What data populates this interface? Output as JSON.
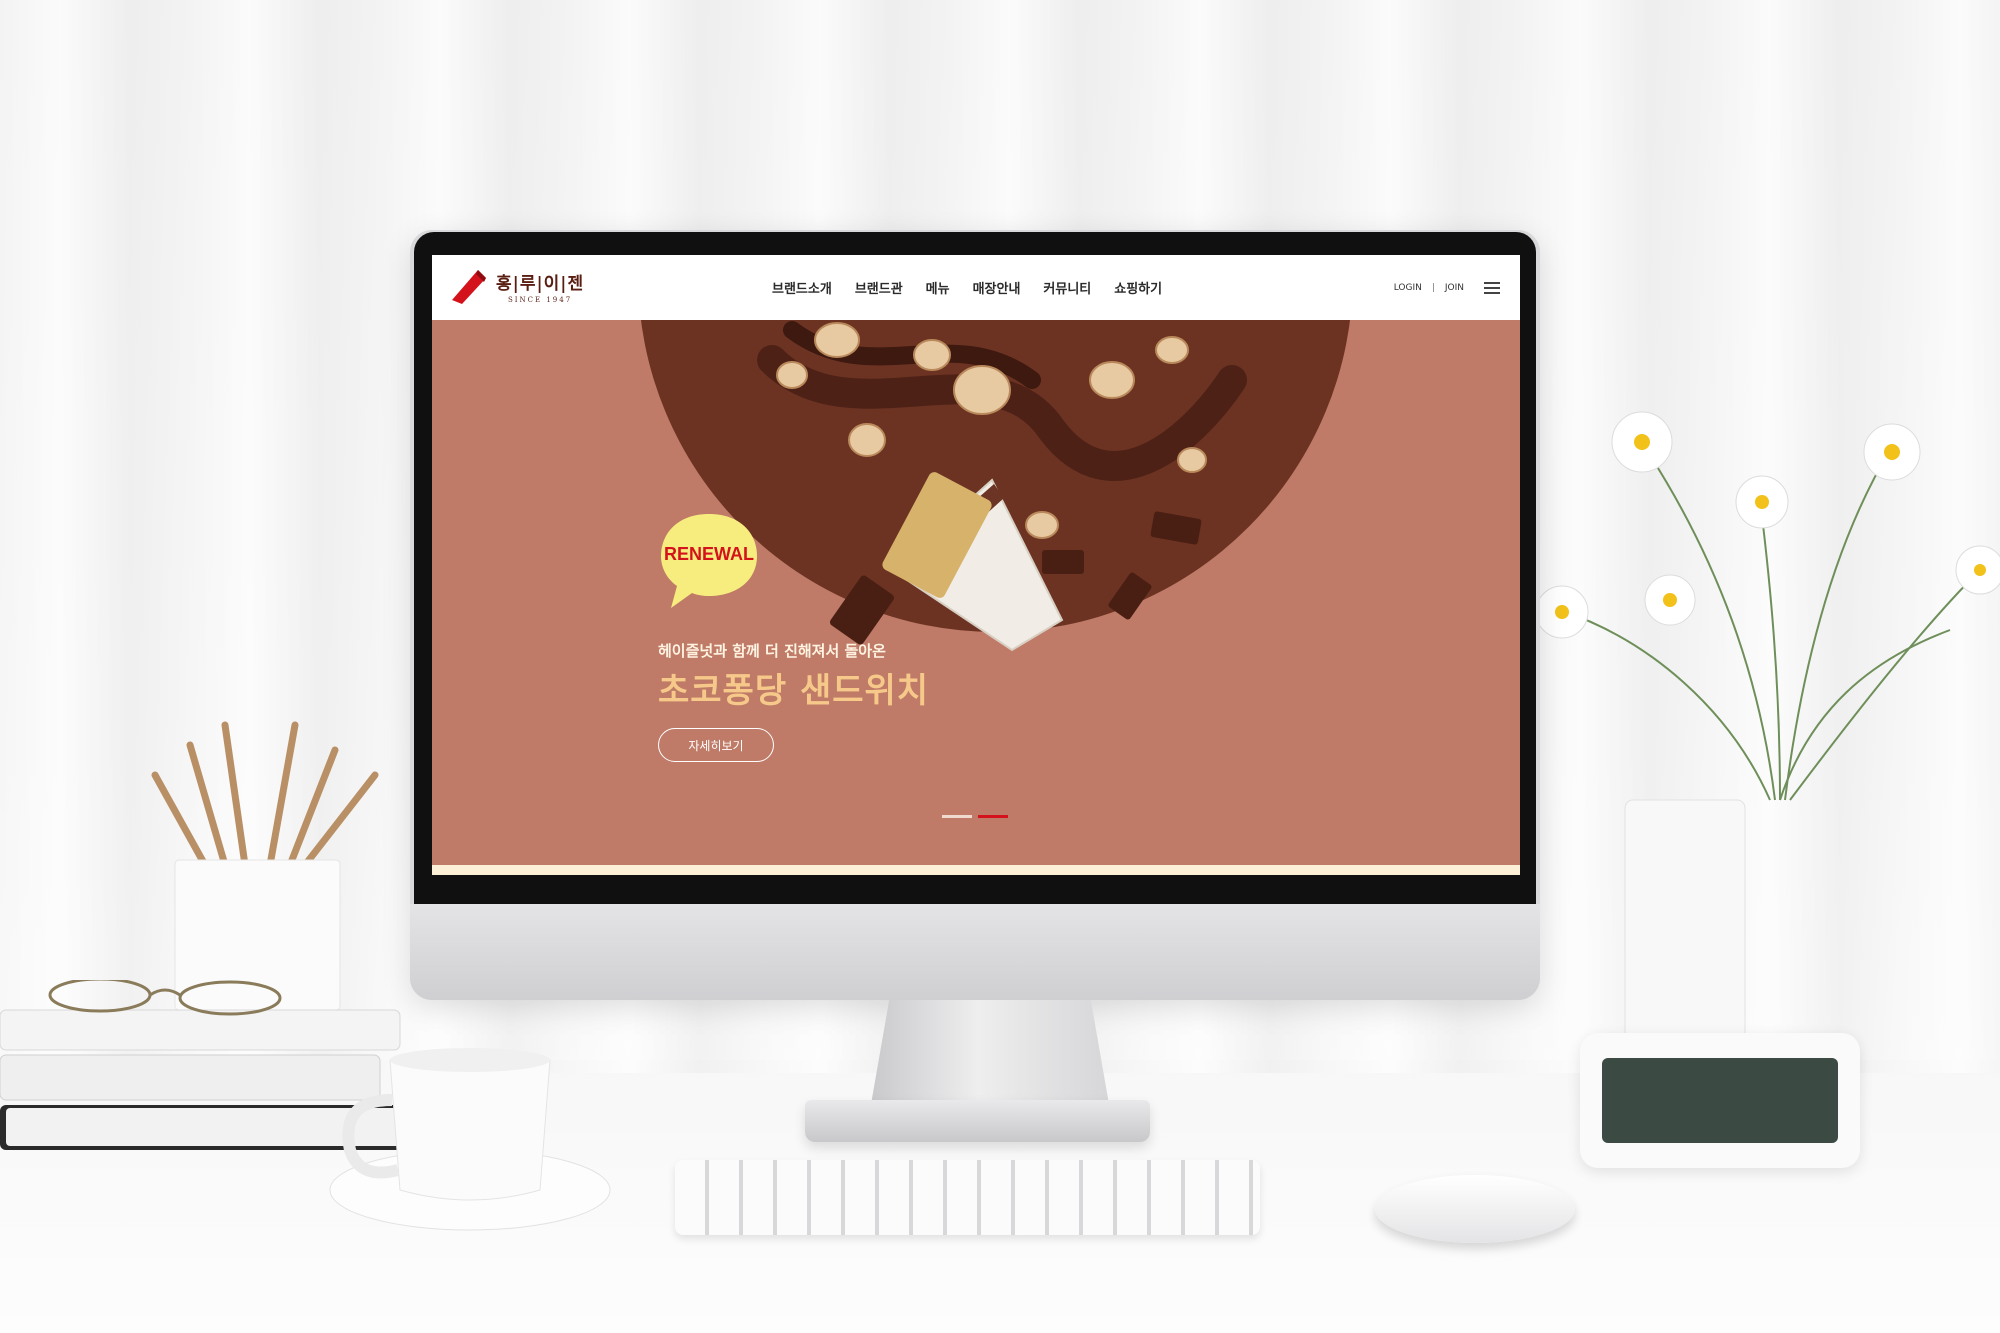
{
  "brand": {
    "name": "홍|루|이|젠",
    "since": "SINCE 1947"
  },
  "nav": {
    "items": [
      "브랜드소개",
      "브랜드관",
      "메뉴",
      "매장안내",
      "커뮤니티",
      "쇼핑하기"
    ]
  },
  "util": {
    "login": "LOGIN",
    "separator": "|",
    "join": "JOIN"
  },
  "hero": {
    "badge": "RENEWAL",
    "sub_copy": "헤이즐넛과 함께 더 진해져서 돌아온",
    "main_copy": "초코퐁당 샌드위치",
    "button_label": "자세히보기",
    "slides": 2,
    "active_slide": 2
  },
  "colors": {
    "hero_bg": "#bf7b67",
    "bowl": "#6c3323",
    "accent": "#d4121b",
    "headline": "#f6c98a"
  }
}
